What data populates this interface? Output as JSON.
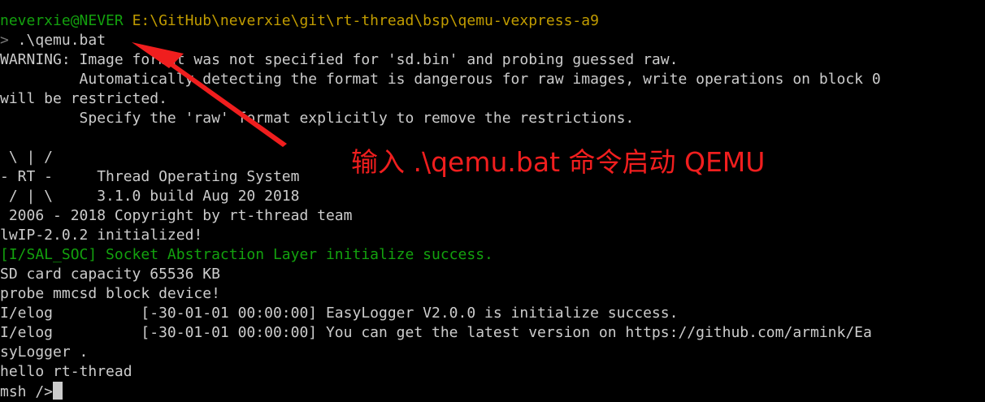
{
  "terminal": {
    "prompt_user": "neverxie@NEVER",
    "prompt_path": "E:\\GitHub\\neverxie\\git\\rt-thread\\bsp\\qemu-vexpress-a9",
    "prompt_symbol": ">",
    "command": " .\\qemu.bat",
    "lines": [
      "WARNING: Image format was not specified for 'sd.bin' and probing guessed raw.",
      "         Automatically detecting the format is dangerous for raw images, write operations on block 0",
      "will be restricted.",
      "         Specify the 'raw' format explicitly to remove the restrictions.",
      "",
      " \\ | /",
      "- RT -     Thread Operating System",
      " / | \\     3.1.0 build Aug 20 2018",
      " 2006 - 2018 Copyright by rt-thread team",
      "lwIP-2.0.2 initialized!",
      "[I/SAL_SOC] Socket Abstraction Layer initialize success.",
      "SD card capacity 65536 KB",
      "probe mmcsd block device!",
      "I/elog          [-30-01-01 00:00:00] EasyLogger V2.0.0 is initialize success.",
      "I/elog          [-30-01-01 00:00:00] You can get the latest version on https://github.com/armink/Ea",
      "syLogger .",
      "hello rt-thread",
      "msh />"
    ]
  },
  "annotation": {
    "text": "输入 .\\qemu.bat 命令启动 QEMU",
    "color": "#f01e1e"
  },
  "colors": {
    "background": "#000000",
    "text": "#cccccc",
    "prompt_green": "#13a10e",
    "path_yellow": "#c19c00",
    "arrow_red": "#f01e1e"
  }
}
